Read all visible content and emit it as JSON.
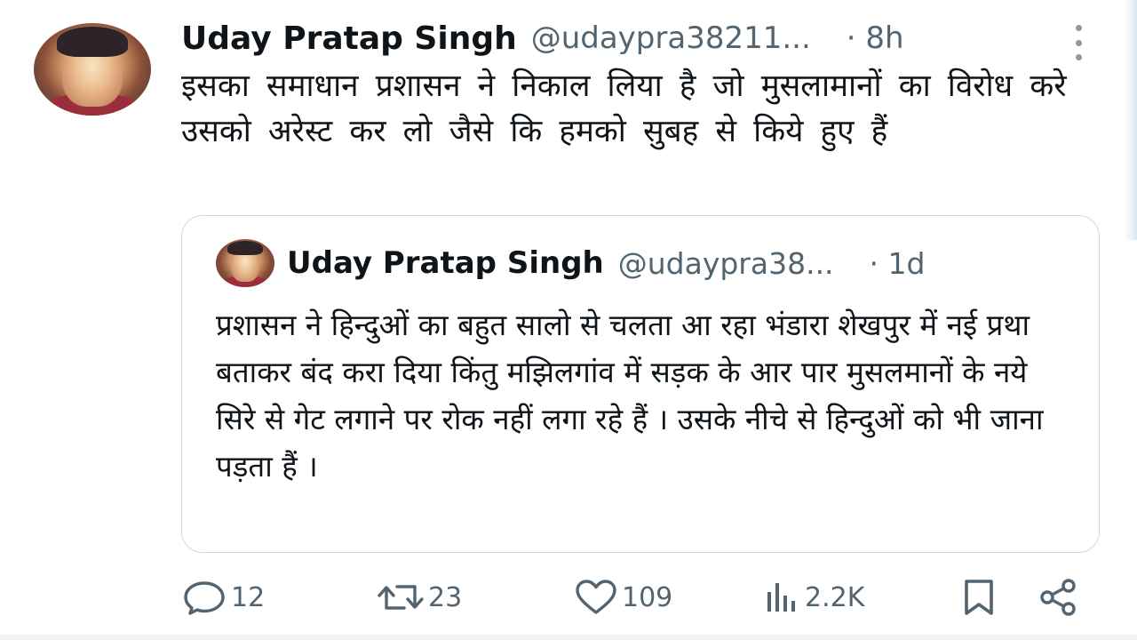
{
  "tweet": {
    "author_name": "Uday Pratap Singh",
    "author_handle": "@udaypra38211...",
    "time": "· 8h",
    "text": "इसका समाधान प्रशासन ने निकाल लिया है जो मुसलामानों का विरोध करे उसको अरेस्ट कर लो जैसे कि हमको सुबह से किये हुए हैं"
  },
  "quoted_tweet": {
    "author_name": "Uday Pratap Singh",
    "author_handle": "@udaypra38...",
    "time": "· 1d",
    "text": "प्रशासन ने हिन्दुओं का बहुत सालो से चलता आ रहा भंडारा शेखपुर में नई प्रथा बताकर बंद करा दिया किंतु मझिलगांव में सड़क के आर पार मुसलमानों के नये सिरे से गेट लगाने पर रोक नहीं लगा रहे हैं । उसके नीचे से हिन्दुओं को भी जाना पड़ता हैं ।"
  },
  "actions": {
    "replies": "12",
    "reposts": "23",
    "likes": "109",
    "views": "2.2K"
  },
  "icons": {
    "reply": "reply-icon",
    "repost": "repost-icon",
    "like": "heart-icon",
    "views": "views-chart-icon",
    "bookmark": "bookmark-icon",
    "share": "share-icon",
    "more": "more-options-icon"
  },
  "colors": {
    "text": "#0f1419",
    "secondary": "#536471",
    "border": "#cfd9de"
  }
}
